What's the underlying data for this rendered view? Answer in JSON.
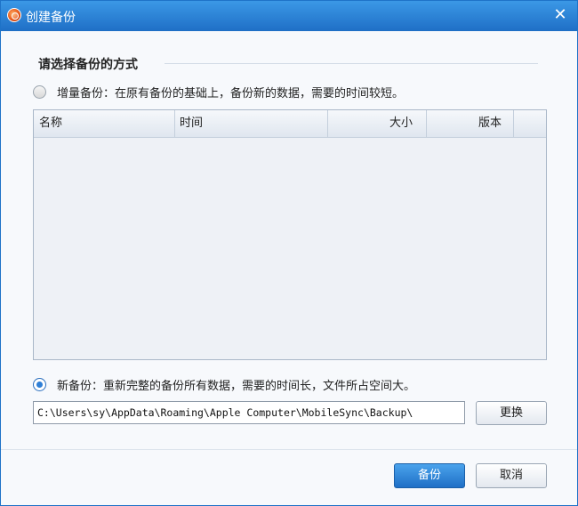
{
  "window": {
    "title": "创建备份"
  },
  "section": {
    "title": "请选择备份的方式"
  },
  "incremental": {
    "label": "增量备份：在原有备份的基础上，备份新的数据，需要的时间较短。",
    "checked": false
  },
  "table": {
    "columns": [
      "名称",
      "时间",
      "大小",
      "版本"
    ],
    "rows": []
  },
  "new_backup": {
    "label": "新备份：重新完整的备份所有数据，需要的时间长，文件所占空间大。",
    "checked": true
  },
  "path": {
    "value": "C:\\Users\\sy\\AppData\\Roaming\\Apple Computer\\MobileSync\\Backup\\"
  },
  "buttons": {
    "change": "更换",
    "backup": "备份",
    "cancel": "取消"
  },
  "colors": {
    "titlebar": "#1f6fc6",
    "accent": "#2f7fd6"
  }
}
